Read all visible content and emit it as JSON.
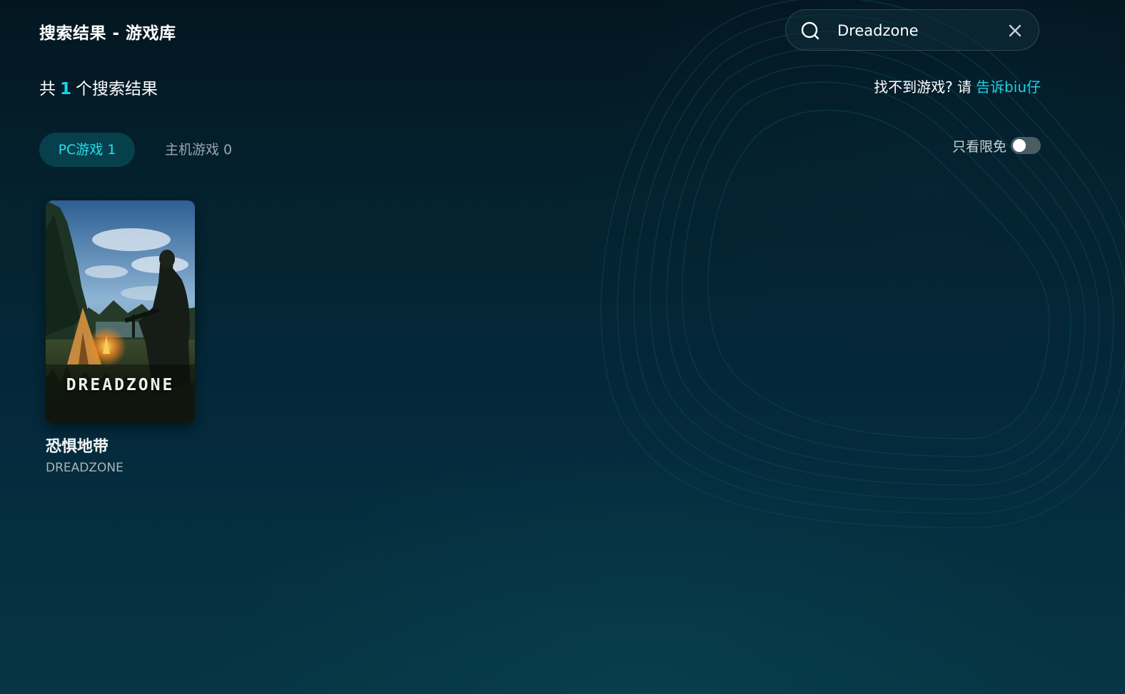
{
  "header": {
    "title": "搜索结果 - 游戏库"
  },
  "search": {
    "value": "Dreadzone",
    "placeholder": ""
  },
  "results": {
    "prefix": "共",
    "count": "1",
    "suffix": "个搜索结果"
  },
  "feedback": {
    "text": "找不到游戏? 请",
    "link": "告诉biu仔"
  },
  "tabs": [
    {
      "label": "PC游戏 1",
      "active": true
    },
    {
      "label": "主机游戏 0",
      "active": false
    }
  ],
  "filter": {
    "label": "只看限免",
    "enabled": false
  },
  "games": [
    {
      "title_cn": "恐惧地带",
      "title_en": "DREADZONE",
      "cover_logo": "DREADZONE"
    }
  ],
  "colors": {
    "accent": "#19d4e6",
    "tab_active_bg": "#06404c",
    "background_top": "#031620",
    "background_bottom": "#063543"
  },
  "icons": {
    "search": "search-icon",
    "clear": "close-icon"
  }
}
